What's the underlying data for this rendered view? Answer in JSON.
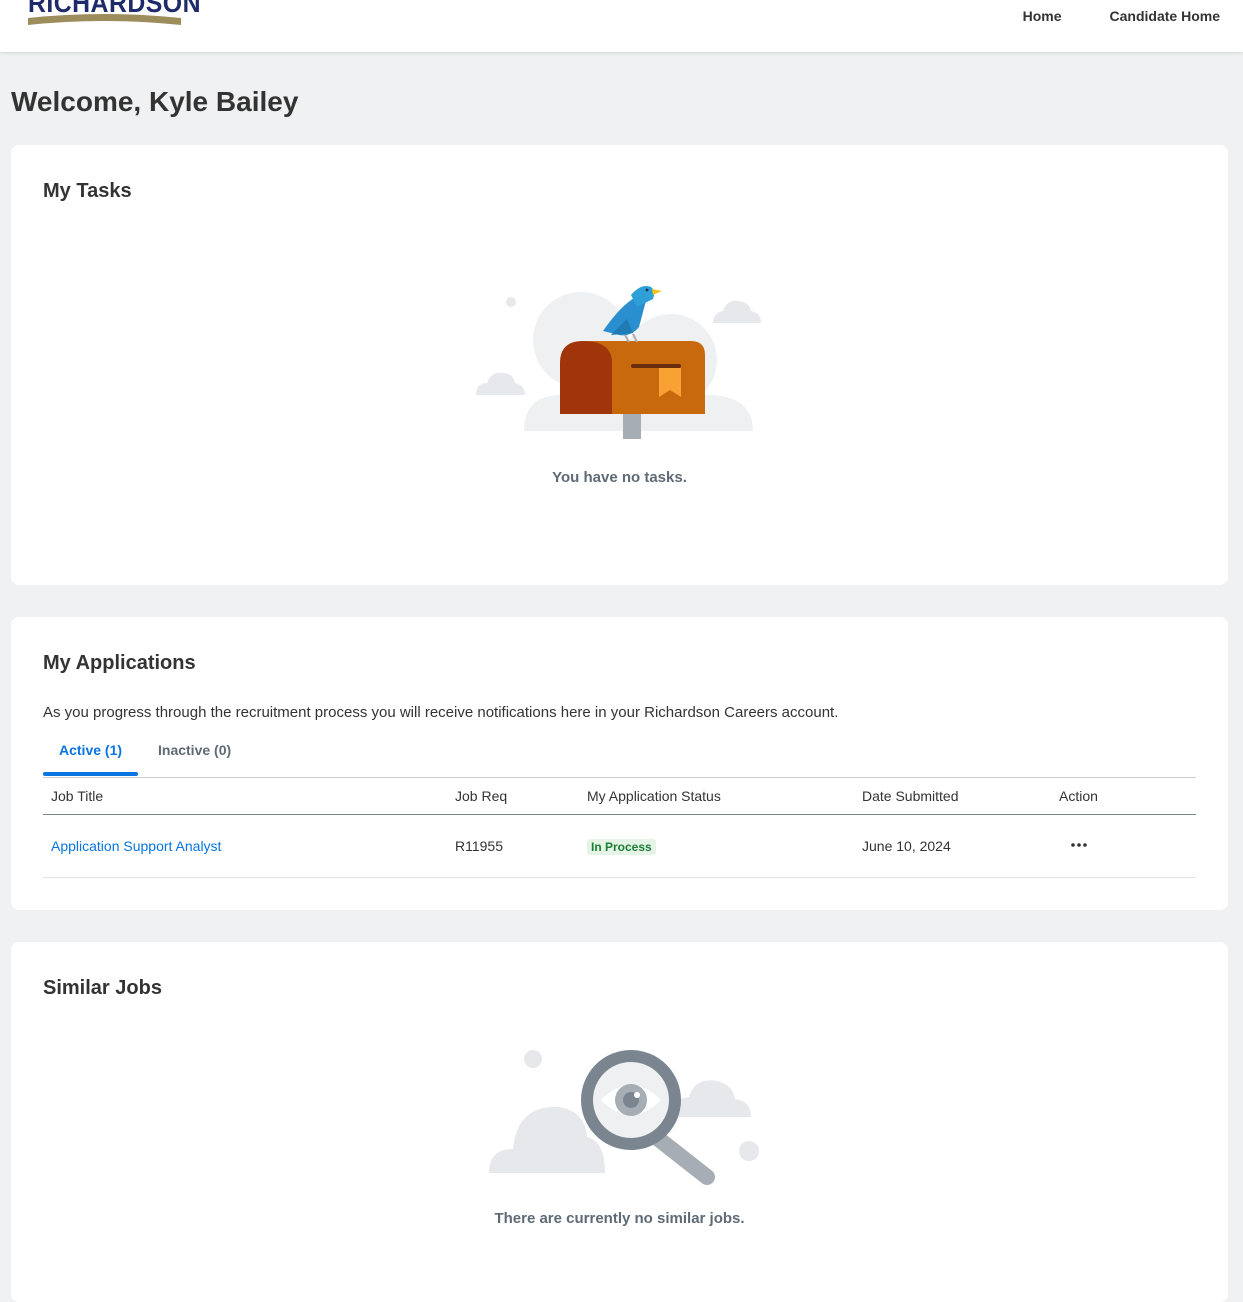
{
  "header": {
    "logo_text": "RICHARDSON",
    "nav": [
      {
        "label": "Home"
      },
      {
        "label": "Candidate Home"
      }
    ]
  },
  "welcome": "Welcome, Kyle Bailey",
  "tasks": {
    "title": "My Tasks",
    "empty_text": "You have no tasks.",
    "illustration_icon": "mailbox-bird-icon"
  },
  "applications": {
    "title": "My Applications",
    "description": "As you progress through the recruitment process you will receive notifications here in your Richardson Careers account.",
    "tabs": [
      {
        "label": "Active (1)",
        "active": true
      },
      {
        "label": "Inactive (0)",
        "active": false
      }
    ],
    "columns": [
      "Job Title",
      "Job Req",
      "My Application Status",
      "Date Submitted",
      "Action"
    ],
    "rows": [
      {
        "job_title": "Application Support Analyst",
        "job_req": "R11955",
        "status": "In Process",
        "date_submitted": "June 10, 2024",
        "action_icon": "more-horizontal-icon"
      }
    ]
  },
  "similar_jobs": {
    "title": "Similar Jobs",
    "empty_text": "There are currently no similar jobs.",
    "illustration_icon": "magnifier-eye-icon"
  },
  "colors": {
    "brand_navy": "#1d2b6b",
    "brand_gold": "#9d8c5c",
    "link_blue": "#0875e1",
    "status_green": "#1b7f35",
    "page_bg": "#f0f1f2"
  }
}
